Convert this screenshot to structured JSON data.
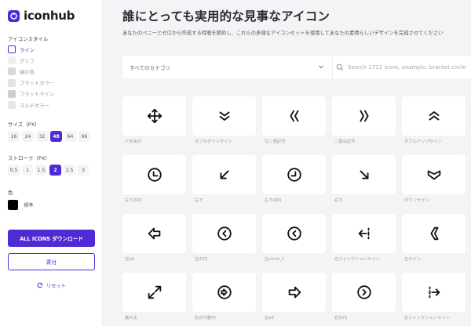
{
  "brand": {
    "name": "iconhub",
    "accent": "#4f2bd6"
  },
  "sidebar": {
    "style_label": "アイコンスタイル",
    "styles": [
      {
        "label": "ライン",
        "active": true,
        "swatch": "#ffffff"
      },
      {
        "label": "グリフ",
        "active": false,
        "swatch": "#eeeeee"
      },
      {
        "label": "線の色",
        "active": false,
        "swatch": "#d9d9dc"
      },
      {
        "label": "フラットカラー",
        "active": false,
        "swatch": "#e3e3e6"
      },
      {
        "label": "フラットライン",
        "active": false,
        "swatch": "#cfcfd3"
      },
      {
        "label": "マルチカラー",
        "active": false,
        "swatch": "#e6e6e9"
      }
    ],
    "size_label": "サイズ（PX）",
    "sizes": [
      "16",
      "24",
      "32",
      "48",
      "64",
      "96"
    ],
    "size_selected": "48",
    "stroke_label": "ストローク（PX）",
    "strokes": [
      "0.5",
      "1",
      "1.5",
      "2",
      "2.5",
      "3"
    ],
    "stroke_selected": "2",
    "color_label": "色",
    "color_value": "#000000",
    "color_name": "標準",
    "download_label": "ALL ICONS ダウンロード",
    "donate_label": "寄付",
    "reset_label": "リセット"
  },
  "main": {
    "title": "誰にとっても実用的な見事なアイコン",
    "subtitle": "あなたのペニーとゼロから作成する時間を節約し、これらの多様なアイコンセットを使用してあなたの素晴らしいデザインを完成させてください",
    "category_label": "すべてのカテゴリ",
    "search_placeholder": "Search 1712 icons, example: bracket circle"
  },
  "icons": [
    {
      "label": "十字矢印",
      "icon": "move-arrows-icon"
    },
    {
      "label": "ダブルダウンサイン",
      "icon": "double-chevron-down-icon"
    },
    {
      "label": "左二重記号",
      "icon": "double-chevron-left-icon"
    },
    {
      "label": "二重右記号",
      "icon": "double-chevron-right-icon"
    },
    {
      "label": "ダブルアップサイン",
      "icon": "double-chevron-up-icon"
    },
    {
      "label": "左下の円",
      "icon": "clock-bottom-left-icon"
    },
    {
      "label": "左下",
      "icon": "arrow-down-left-icon"
    },
    {
      "label": "右下の円",
      "icon": "clock-bottom-right-icon"
    },
    {
      "label": "右下",
      "icon": "arrow-down-right-icon"
    },
    {
      "label": "ダウンサイン",
      "icon": "down-sign-icon"
    },
    {
      "label": "左alt",
      "icon": "arrow-left-alt-icon"
    },
    {
      "label": "左の円",
      "icon": "chevron-left-circle-icon"
    },
    {
      "label": "左circle_1",
      "icon": "chevron-left-circle-1-icon"
    },
    {
      "label": "左ジャンクションサイン",
      "icon": "left-junction-icon"
    },
    {
      "label": "左サイン",
      "icon": "left-sign-icon"
    },
    {
      "label": "最大化",
      "icon": "maximize-icon"
    },
    {
      "label": "右の代替円",
      "icon": "arrow-right-circle-alt-icon"
    },
    {
      "label": "右alt",
      "icon": "arrow-right-alt-icon"
    },
    {
      "label": "右の円",
      "icon": "chevron-right-circle-icon"
    },
    {
      "label": "右ジャンクションサイン",
      "icon": "right-junction-icon"
    }
  ]
}
